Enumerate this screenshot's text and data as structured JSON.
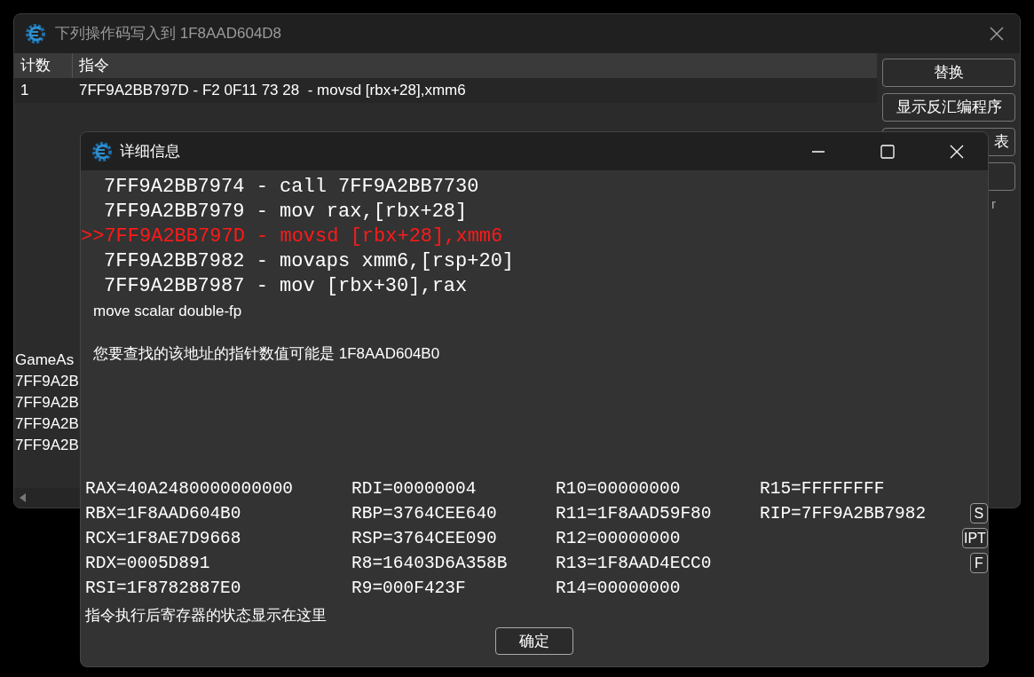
{
  "main_window": {
    "title": "下列操作码写入到 1F8AAD604D8",
    "table": {
      "columns": [
        "计数",
        "指令"
      ],
      "rows": [
        {
          "count": "1",
          "instruction": "7FF9A2BB797D - F2 0F11 73 28  - movsd [rbx+28],xmm6"
        }
      ]
    },
    "buttons": [
      "替换",
      "显示反汇编程序",
      "表"
    ],
    "side_text": "r",
    "list": [
      "GameAs",
      "7FF9A2B",
      "7FF9A2B",
      "7FF9A2B",
      "7FF9A2B"
    ]
  },
  "details_dialog": {
    "title": "详细信息",
    "disassembly": [
      {
        "text": "7FF9A2BB7974 - call 7FF9A2BB7730",
        "current": false
      },
      {
        "text": "7FF9A2BB7979 - mov rax,[rbx+28]",
        "current": false
      },
      {
        "prefix": ">>",
        "text": "7FF9A2BB797D - movsd [rbx+28],xmm6",
        "current": true
      },
      {
        "text": "7FF9A2BB7982 - movaps xmm6,[rsp+20]",
        "current": false
      },
      {
        "text": "7FF9A2BB7987 - mov [rbx+30],rax",
        "current": false
      }
    ],
    "description": "move scalar double-fp",
    "pointer_hint": "您要查找的该地址的指针数值可能是 1F8AAD604B0",
    "registers": [
      [
        "RAX=40A2480000000000",
        "RDI=00000004",
        "R10=00000000",
        "R15=FFFFFFFF"
      ],
      [
        "RBX=1F8AAD604B0",
        "RBP=3764CEE640",
        "R11=1F8AAD59F80",
        "RIP=7FF9A2BB7982"
      ],
      [
        "RCX=1F8AE7D9668",
        "RSP=3764CEE090",
        "R12=00000000"
      ],
      [
        "RDX=0005D891",
        "R8=16403D6A358B",
        "R13=1F8AAD4ECC0"
      ],
      [
        "RSI=1F8782887E0",
        "R9=000F423F",
        "R14=00000000"
      ]
    ],
    "side_buttons": [
      "S",
      "IPT",
      "F"
    ],
    "footer": "指令执行后寄存器的状态显示在这里",
    "ok_button": "确定"
  }
}
